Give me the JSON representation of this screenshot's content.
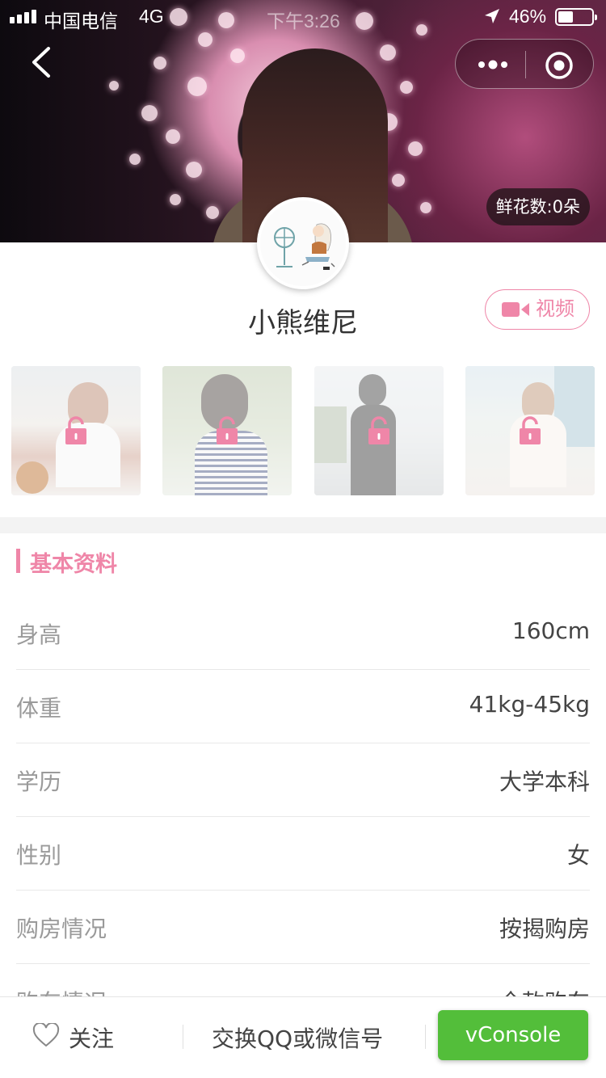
{
  "status_bar": {
    "carrier": "中国电信",
    "network": "4G",
    "time": "下午3:26",
    "battery_percent": "46%",
    "battery_level": 0.46,
    "signal_bars": 4
  },
  "nav": {
    "back_icon": "chevron-left-icon",
    "more_icon": "more-dots-icon",
    "close_icon": "target-circle-icon"
  },
  "profile": {
    "flowers_label": "鲜花数:0朵",
    "nickname": "小熊维尼",
    "video_button_label": "视频",
    "video_icon": "video-camera-icon",
    "photos": [
      {
        "locked": true,
        "lock_icon": "lock-icon"
      },
      {
        "locked": true,
        "lock_icon": "lock-icon"
      },
      {
        "locked": true,
        "lock_icon": "lock-icon"
      },
      {
        "locked": true,
        "lock_icon": "lock-icon"
      }
    ]
  },
  "basic_info": {
    "section_title": "基本资料",
    "rows": [
      {
        "label": "身高",
        "value": "160cm"
      },
      {
        "label": "体重",
        "value": "41kg-45kg"
      },
      {
        "label": "学历",
        "value": "大学本科"
      },
      {
        "label": "性别",
        "value": "女"
      },
      {
        "label": "购房情况",
        "value": "按揭购房"
      },
      {
        "label": "购车情况",
        "value": "全款购车"
      }
    ]
  },
  "bottom_bar": {
    "follow_label": "关注",
    "exchange_label": "交换QQ或微信号",
    "vconsole_label": "vConsole"
  },
  "colors": {
    "accent_pink": "#ef86a8",
    "vconsole_green": "#53be3a"
  }
}
